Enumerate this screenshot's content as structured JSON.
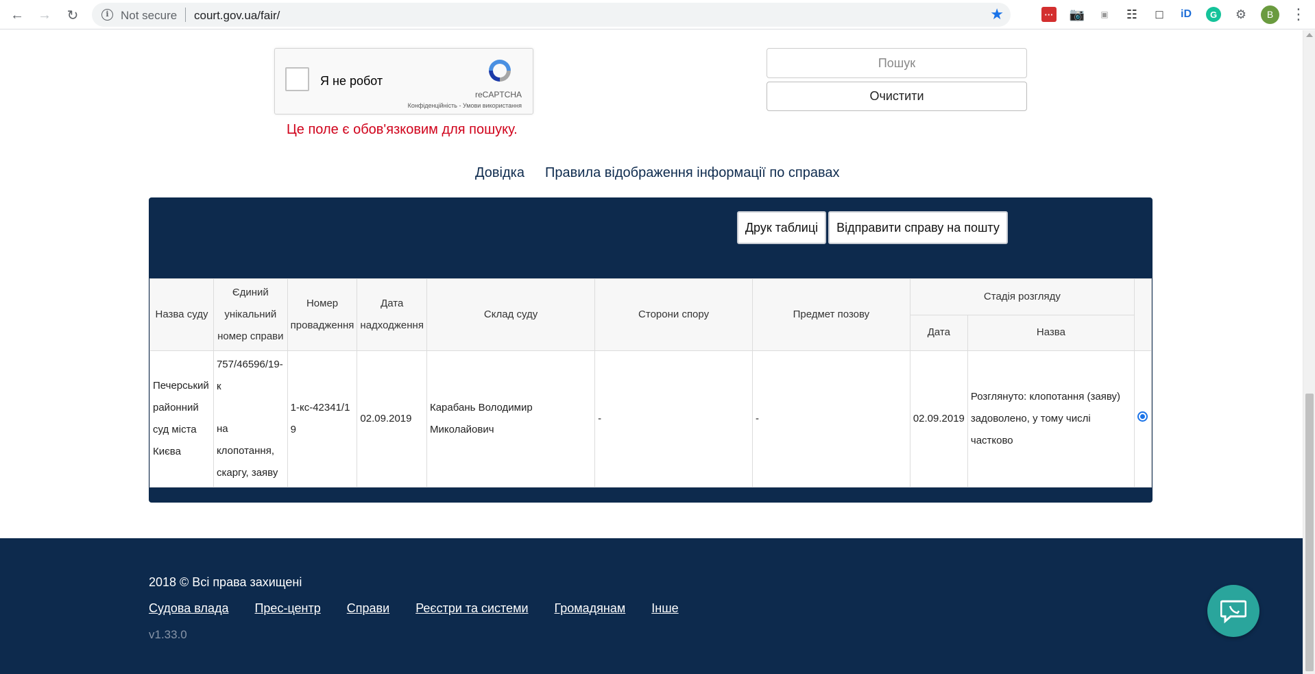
{
  "browser": {
    "security_label": "Not secure",
    "url": "court.gov.ua/fair/",
    "profile_initial": "B"
  },
  "captcha": {
    "label": "Я не робот",
    "brand": "reCAPTCHA",
    "links": "Конфіденційність - Умови використання",
    "error": "Це поле є обов'язковим для пошуку."
  },
  "search": {
    "search_label": "Пошук",
    "clear_label": "Очистити"
  },
  "info_links": {
    "help": "Довідка",
    "rules": "Правила відображення інформації по справах"
  },
  "table_actions": {
    "print_label": "Друк таблиці",
    "send_label": "Відправити справу на пошту"
  },
  "table": {
    "headers": {
      "court": "Назва суду",
      "case_number": "Єдиний унікальний номер справи",
      "proceeding": "Номер провадження",
      "received": "Дата надходження",
      "panel": "Склад суду",
      "parties": "Сторони спору",
      "subject": "Предмет позову",
      "stage": "Стадія розгляду",
      "stage_date": "Дата",
      "stage_name": "Назва"
    },
    "rows": [
      {
        "court": "Печерський районний суд міста Києва",
        "case_number": "757/46596/19-к",
        "case_type": "на клопотання, скаргу, заяву",
        "proceeding": "1-кс-42341/19",
        "received": "02.09.2019",
        "panel": "Карабань Володимир Миколайович",
        "parties": "-",
        "subject": "-",
        "stage_date": "02.09.2019",
        "stage_name": "Розглянуто: клопотання (заяву) задоволено, у тому числі частково"
      }
    ]
  },
  "footer": {
    "copyright": "2018 © Всі права захищені",
    "links": [
      "Судова влада",
      "Прес-центр",
      "Справи",
      "Реєстри та системи",
      "Громадянам",
      "Інше"
    ],
    "version": "v1.33.0"
  },
  "colors": {
    "navy": "#0d2a4d",
    "error": "#d0021b",
    "chat": "#2aa59c"
  }
}
